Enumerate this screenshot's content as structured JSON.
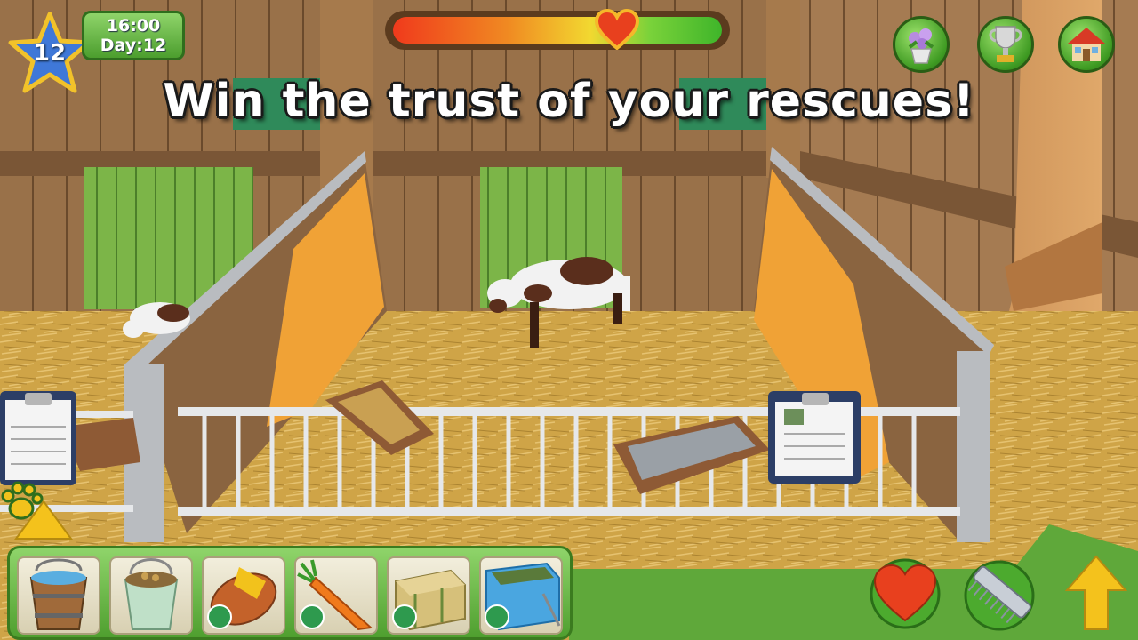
{
  "hud": {
    "level": "12",
    "clock_time": "16:00",
    "clock_day": "Day:12",
    "happiness_value": 0.68
  },
  "banner": {
    "message": "Win the trust of your rescues!"
  },
  "colors": {
    "hud_green": "#4c9e2e",
    "star_blue": "#3f78d8",
    "heart_red": "#e8401e",
    "arrow_yellow": "#f4c21c"
  },
  "top_buttons": [
    {
      "icon": "flowers-icon"
    },
    {
      "icon": "trophy-icon"
    },
    {
      "icon": "home-icon"
    }
  ],
  "toolbar": {
    "slots": [
      {
        "icon": "water-bucket-icon",
        "badge": false
      },
      {
        "icon": "feed-bucket-icon",
        "badge": false
      },
      {
        "icon": "salt-lick-icon",
        "badge": true,
        "badge_icon": "goat-badge-icon"
      },
      {
        "icon": "carrot-icon",
        "badge": true,
        "badge_icon": "goat-badge-icon"
      },
      {
        "icon": "hay-bale-icon",
        "badge": true,
        "badge_icon": "goat-badge-icon"
      },
      {
        "icon": "feed-box-icon",
        "badge": true,
        "badge_icon": "goat-badge-icon"
      }
    ]
  },
  "bottom_right": [
    {
      "icon": "heart-icon"
    },
    {
      "icon": "comb-icon"
    },
    {
      "icon": "up-arrow-icon"
    }
  ]
}
